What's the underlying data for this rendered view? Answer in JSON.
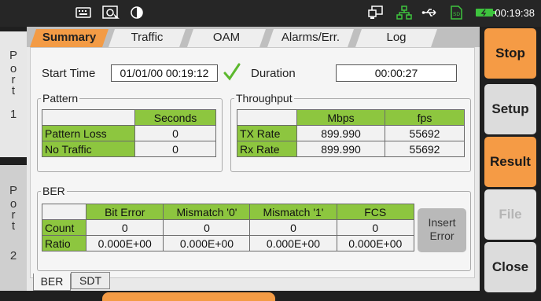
{
  "status": {
    "time": "00:19:38",
    "colors": {
      "green": "#3ec43e",
      "bar_bg": "#262626"
    }
  },
  "ports": [
    {
      "letters": [
        "P",
        "o",
        "r",
        "t"
      ],
      "number": "1"
    },
    {
      "letters": [
        "P",
        "o",
        "r",
        "t"
      ],
      "number": "2"
    }
  ],
  "tabs": [
    "Summary",
    "Traffic",
    "OAM",
    "Alarms/Err.",
    "Log"
  ],
  "summary": {
    "start_time_label": "Start Time",
    "start_time_value": "01/01/00 00:19:12",
    "duration_label": "Duration",
    "duration_value": "00:00:27"
  },
  "pattern": {
    "title": "Pattern",
    "header": "Seconds",
    "rows": [
      {
        "label": "Pattern Loss",
        "value": "0"
      },
      {
        "label": "No Traffic",
        "value": "0"
      }
    ]
  },
  "throughput": {
    "title": "Throughput",
    "headers": [
      "Mbps",
      "fps"
    ],
    "rows": [
      {
        "label": "TX Rate",
        "mbps": "899.990",
        "fps": "55692"
      },
      {
        "label": "Rx Rate",
        "mbps": "899.990",
        "fps": "55692"
      }
    ]
  },
  "ber": {
    "title": "BER",
    "headers": [
      "Bit Error",
      "Mismatch '0'",
      "Mismatch '1'",
      "FCS"
    ],
    "count_label": "Count",
    "count": [
      "0",
      "0",
      "0",
      "0"
    ],
    "ratio_label": "Ratio",
    "ratio": [
      "0.000E+00",
      "0.000E+00",
      "0.000E+00",
      "0.000E+00"
    ],
    "insert_line1": "Insert",
    "insert_line2": "Error"
  },
  "bottom_tabs": [
    "BER",
    "SDT"
  ],
  "side_buttons": [
    "Stop",
    "Setup",
    "Result",
    "File",
    "Close"
  ]
}
